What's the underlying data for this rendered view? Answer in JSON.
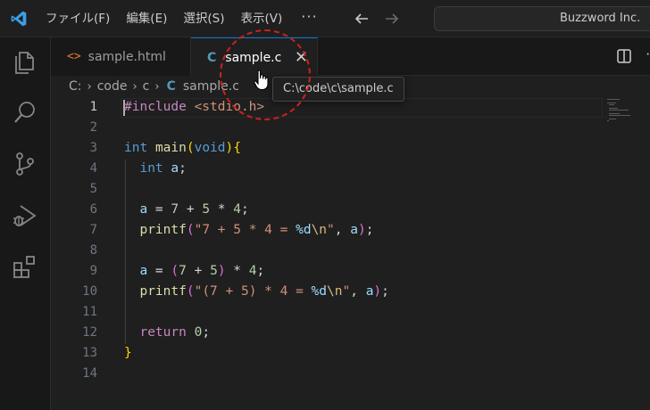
{
  "titlebar": {
    "menus": [
      "ファイル(F)",
      "編集(E)",
      "選択(S)",
      "表示(V)"
    ],
    "more": "···",
    "search_text": "Buzzword Inc."
  },
  "activitybar": {
    "icons": [
      "explorer-icon",
      "search-icon",
      "source-control-icon",
      "run-debug-icon",
      "extensions-icon"
    ]
  },
  "tabs": [
    {
      "label": "sample.html",
      "glyph": "<>",
      "active": false
    },
    {
      "label": "sample.c",
      "glyph": "C",
      "active": true
    }
  ],
  "breadcrumb": {
    "items": [
      "C:",
      "code",
      "c",
      "sample.c"
    ],
    "file_glyph": "C"
  },
  "tooltip": {
    "text": "C:\\code\\c\\sample.c"
  },
  "editor": {
    "active_line": 1,
    "line_numbers": [
      "1",
      "2",
      "3",
      "4",
      "5",
      "6",
      "7",
      "8",
      "9",
      "10",
      "11",
      "12",
      "13",
      "14"
    ],
    "lines": [
      [
        {
          "t": "#include ",
          "c": "kw-dir"
        },
        {
          "t": "<stdio.h>",
          "c": "str"
        }
      ],
      [],
      [
        {
          "t": "int",
          "c": "type"
        },
        {
          "t": " ",
          "c": "plain"
        },
        {
          "t": "main",
          "c": "fn"
        },
        {
          "t": "(",
          "c": "br1"
        },
        {
          "t": "void",
          "c": "type"
        },
        {
          "t": ")",
          "c": "br1"
        },
        {
          "t": "{",
          "c": "br1"
        }
      ],
      [
        {
          "t": "  ",
          "c": "plain"
        },
        {
          "t": "int",
          "c": "type"
        },
        {
          "t": " ",
          "c": "plain"
        },
        {
          "t": "a",
          "c": "var"
        },
        {
          "t": ";",
          "c": "plain"
        }
      ],
      [],
      [
        {
          "t": "  ",
          "c": "plain"
        },
        {
          "t": "a",
          "c": "var"
        },
        {
          "t": " = ",
          "c": "op"
        },
        {
          "t": "7",
          "c": "num"
        },
        {
          "t": " + ",
          "c": "op"
        },
        {
          "t": "5",
          "c": "num"
        },
        {
          "t": " * ",
          "c": "op"
        },
        {
          "t": "4",
          "c": "num"
        },
        {
          "t": ";",
          "c": "plain"
        }
      ],
      [
        {
          "t": "  ",
          "c": "plain"
        },
        {
          "t": "printf",
          "c": "fn"
        },
        {
          "t": "(",
          "c": "br2"
        },
        {
          "t": "\"7 + 5 * 4 = ",
          "c": "str"
        },
        {
          "t": "%d",
          "c": "fmt"
        },
        {
          "t": "\\n",
          "c": "esc"
        },
        {
          "t": "\"",
          "c": "str"
        },
        {
          "t": ", ",
          "c": "plain"
        },
        {
          "t": "a",
          "c": "var"
        },
        {
          "t": ")",
          "c": "br2"
        },
        {
          "t": ";",
          "c": "plain"
        }
      ],
      [],
      [
        {
          "t": "  ",
          "c": "plain"
        },
        {
          "t": "a",
          "c": "var"
        },
        {
          "t": " = ",
          "c": "op"
        },
        {
          "t": "(",
          "c": "br2"
        },
        {
          "t": "7",
          "c": "num"
        },
        {
          "t": " + ",
          "c": "op"
        },
        {
          "t": "5",
          "c": "num"
        },
        {
          "t": ")",
          "c": "br2"
        },
        {
          "t": " * ",
          "c": "op"
        },
        {
          "t": "4",
          "c": "num"
        },
        {
          "t": ";",
          "c": "plain"
        }
      ],
      [
        {
          "t": "  ",
          "c": "plain"
        },
        {
          "t": "printf",
          "c": "fn"
        },
        {
          "t": "(",
          "c": "br2"
        },
        {
          "t": "\"(7 + 5) * 4 = ",
          "c": "str"
        },
        {
          "t": "%d",
          "c": "fmt"
        },
        {
          "t": "\\n",
          "c": "esc"
        },
        {
          "t": "\"",
          "c": "str"
        },
        {
          "t": ", ",
          "c": "plain"
        },
        {
          "t": "a",
          "c": "var"
        },
        {
          "t": ")",
          "c": "br2"
        },
        {
          "t": ";",
          "c": "plain"
        }
      ],
      [],
      [
        {
          "t": "  ",
          "c": "plain"
        },
        {
          "t": "return",
          "c": "ctrl"
        },
        {
          "t": " ",
          "c": "plain"
        },
        {
          "t": "0",
          "c": "num"
        },
        {
          "t": ";",
          "c": "plain"
        }
      ],
      [
        {
          "t": "}",
          "c": "br1"
        }
      ],
      []
    ]
  },
  "colors": {
    "accent": "#0078d4",
    "annotation": "#d02020"
  }
}
